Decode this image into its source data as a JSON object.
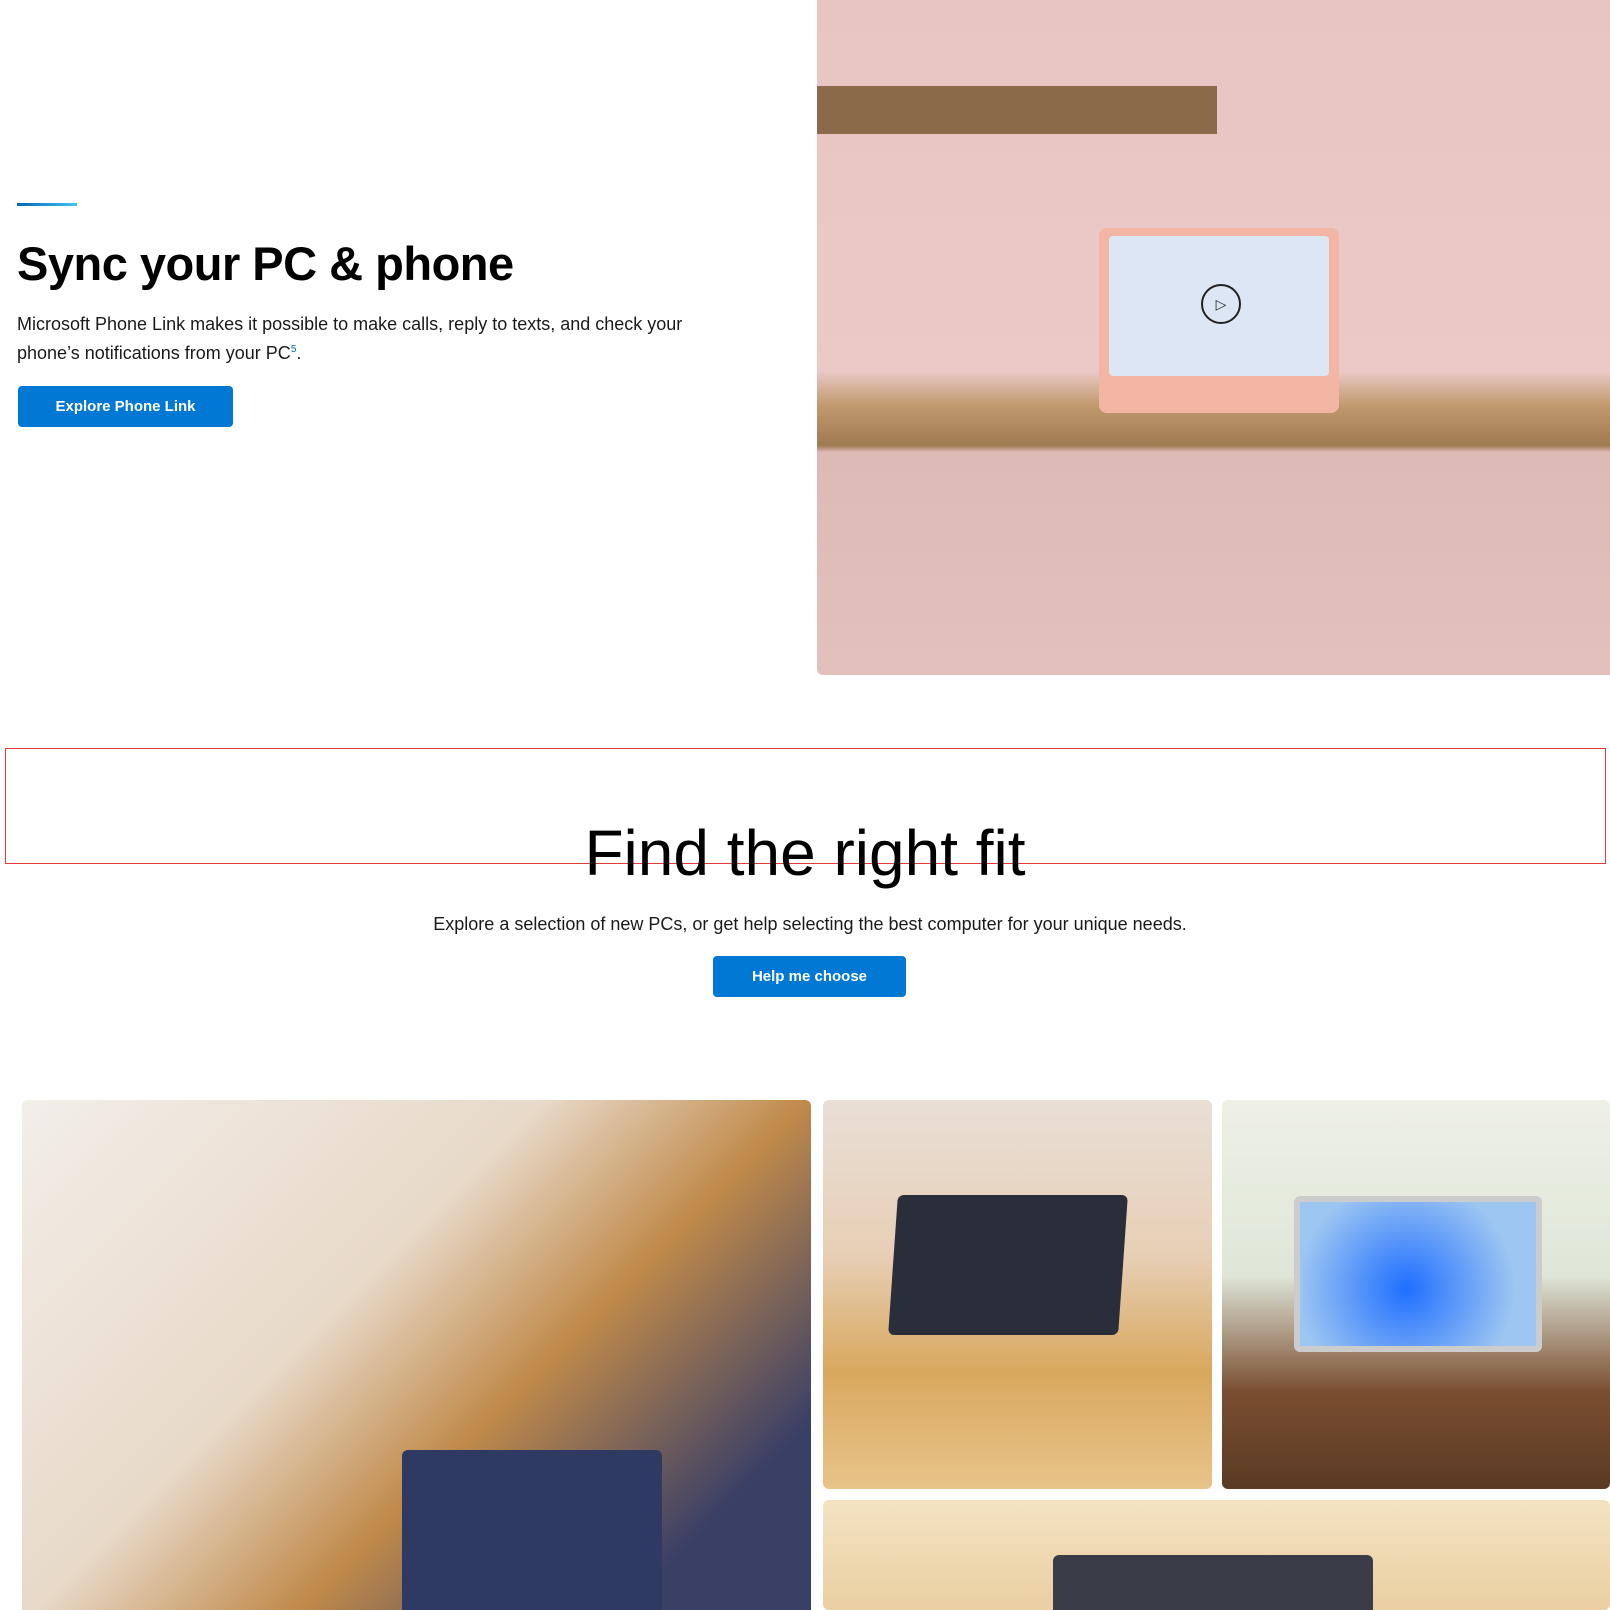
{
  "sync": {
    "heading": "Sync your PC & phone",
    "body": "Microsoft Phone Link makes it possible to make calls, reply to texts, and check your phone’s notifications from your PC",
    "footnote": "5",
    "body_end": ".",
    "button": "Explore Phone Link",
    "play_icon": "▷"
  },
  "fit": {
    "heading": "Find the right fit",
    "body": "Explore a selection of new PCs, or get help selecting the best computer for your unique needs.",
    "button": "Help me choose"
  },
  "colors": {
    "accent": "#0078d4",
    "highlight_box": "#e53935"
  }
}
